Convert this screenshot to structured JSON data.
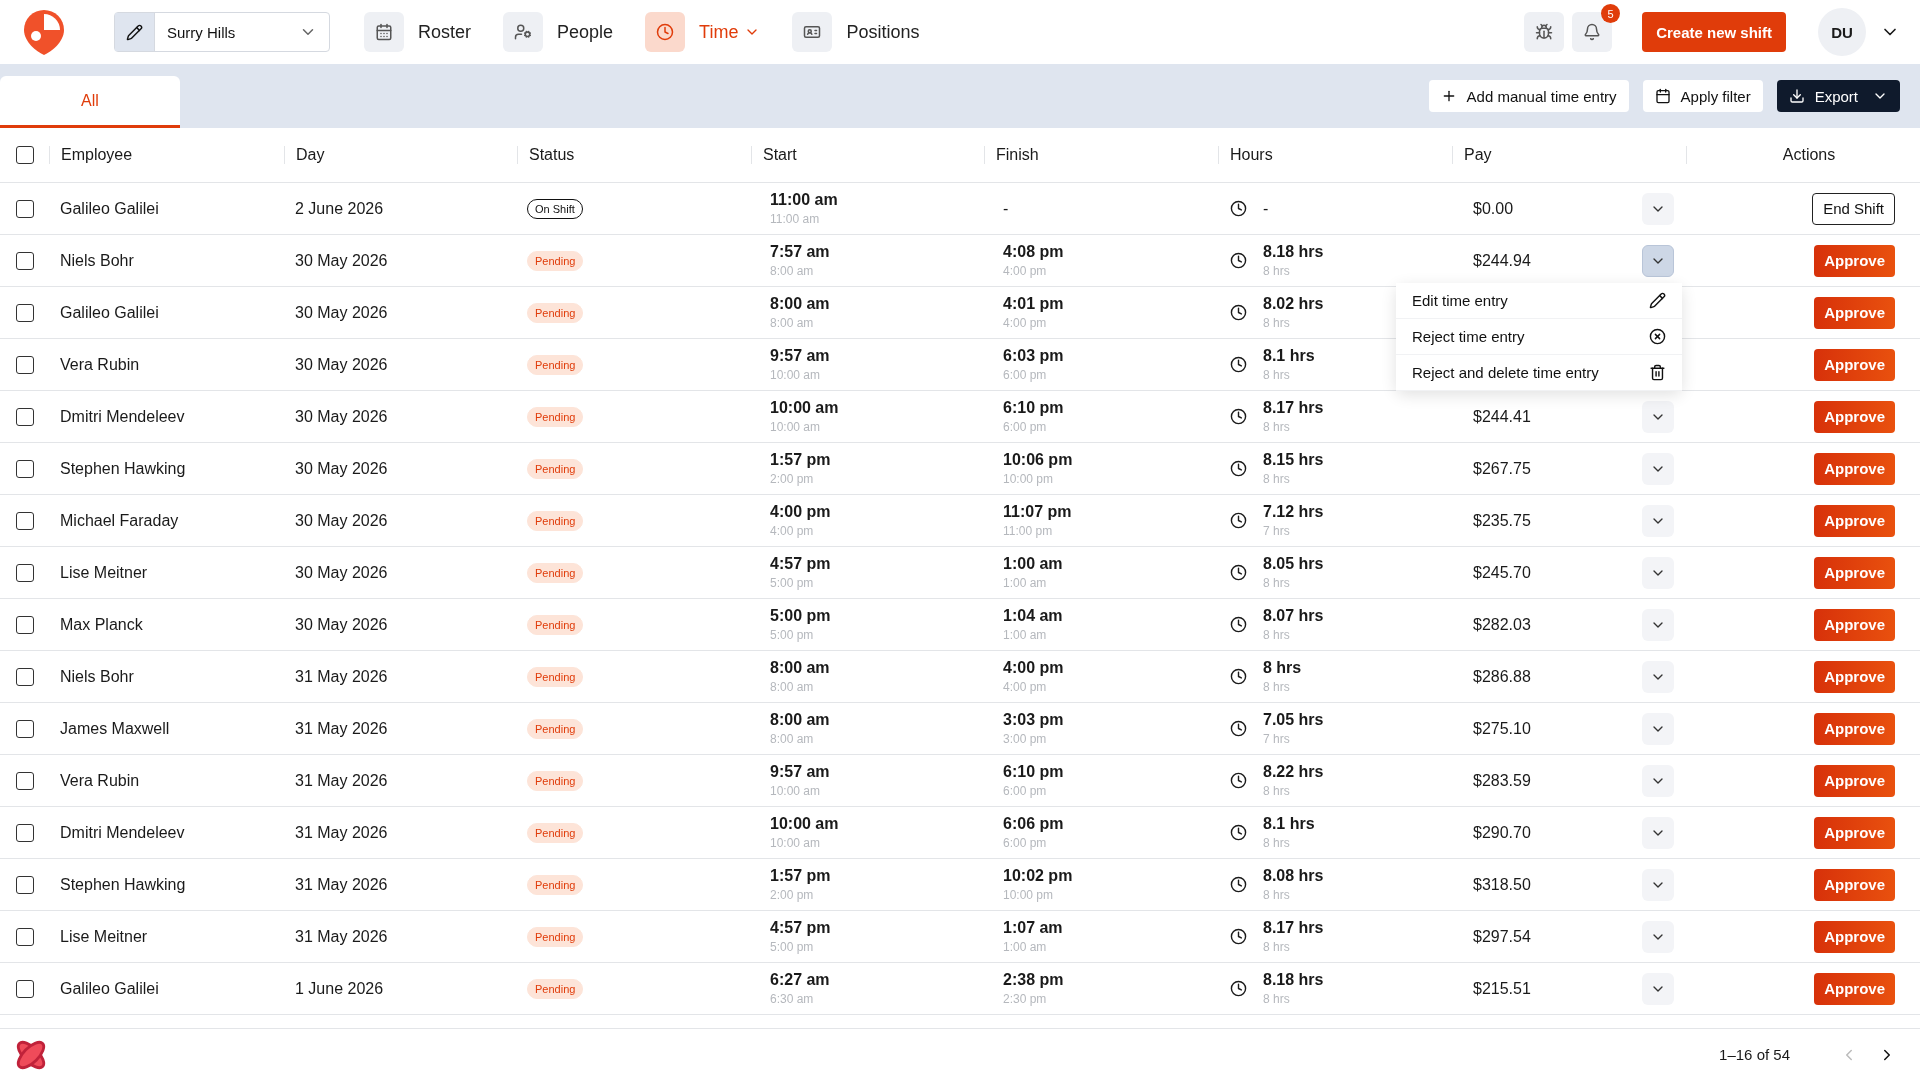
{
  "top_bar": {
    "location": "Surry Hills",
    "nav": [
      {
        "label": "Roster",
        "selected": false,
        "has_menu": false
      },
      {
        "label": "People",
        "selected": false,
        "has_menu": false
      },
      {
        "label": "Time",
        "selected": true,
        "has_menu": true
      },
      {
        "label": "Positions",
        "selected": false,
        "has_menu": false
      }
    ],
    "notification_count": "5",
    "create_button": "Create new shift",
    "avatar": "DU"
  },
  "tabs": [
    {
      "label": "All",
      "selected": true
    }
  ],
  "toolbar": [
    {
      "label": "Add manual time entry",
      "kind": "light"
    },
    {
      "label": "Apply filter",
      "kind": "light"
    },
    {
      "label": "Export",
      "kind": "dark"
    }
  ],
  "table": {
    "select_all": {
      "checked": false
    },
    "columns": [
      "Employee",
      "Day",
      "Status",
      "Start",
      "Finish",
      "Hours",
      "Pay",
      "Actions"
    ],
    "rows": [
      {
        "checked": false,
        "employee": "Galileo Galilei",
        "day": "2 June 2026",
        "status": {
          "label": "On Shift",
          "kind": "on_shift"
        },
        "start": "11:00 am",
        "start_planned": "11:00 am",
        "finish": "-",
        "hours": "-",
        "pay": "$0.00",
        "expanded": false,
        "action": {
          "label": "End Shift",
          "kind": "outline"
        }
      },
      {
        "checked": false,
        "employee": "Niels Bohr",
        "day": "30 May 2026",
        "status": {
          "label": "Pending",
          "kind": "pending"
        },
        "start": "7:57 am",
        "start_planned": "8:00 am",
        "finish": "4:08 pm",
        "finish_planned": "4:00 pm",
        "hours": "8.18 hrs",
        "hours_planned": "8 hrs",
        "pay": "$244.94",
        "expanded": true,
        "action": {
          "label": "Approve",
          "kind": "primary"
        }
      },
      {
        "checked": false,
        "employee": "Galileo Galilei",
        "day": "30 May 2026",
        "status": {
          "label": "Pending",
          "kind": "pending"
        },
        "start": "8:00 am",
        "start_planned": "8:00 am",
        "finish": "4:01 pm",
        "finish_planned": "4:00 pm",
        "hours": "8.02 hrs",
        "hours_planned": "8 hrs",
        "action": {
          "label": "Approve",
          "kind": "primary"
        }
      },
      {
        "checked": false,
        "employee": "Vera Rubin",
        "day": "30 May 2026",
        "status": {
          "label": "Pending",
          "kind": "pending"
        },
        "start": "9:57 am",
        "start_planned": "10:00 am",
        "finish": "6:03 pm",
        "finish_planned": "6:00 pm",
        "hours": "8.1 hrs",
        "hours_planned": "8 hrs",
        "action": {
          "label": "Approve",
          "kind": "primary"
        }
      },
      {
        "checked": false,
        "employee": "Dmitri Mendeleev",
        "day": "30 May 2026",
        "status": {
          "label": "Pending",
          "kind": "pending"
        },
        "start": "10:00 am",
        "start_planned": "10:00 am",
        "finish": "6:10 pm",
        "finish_planned": "6:00 pm",
        "hours": "8.17 hrs",
        "hours_planned": "8 hrs",
        "pay": "$244.41",
        "expanded": false,
        "action": {
          "label": "Approve",
          "kind": "primary"
        }
      },
      {
        "checked": false,
        "employee": "Stephen Hawking",
        "day": "30 May 2026",
        "status": {
          "label": "Pending",
          "kind": "pending"
        },
        "start": "1:57 pm",
        "start_planned": "2:00 pm",
        "finish": "10:06 pm",
        "finish_planned": "10:00 pm",
        "hours": "8.15 hrs",
        "hours_planned": "8 hrs",
        "pay": "$267.75",
        "expanded": false,
        "action": {
          "label": "Approve",
          "kind": "primary"
        }
      },
      {
        "checked": false,
        "employee": "Michael Faraday",
        "day": "30 May 2026",
        "status": {
          "label": "Pending",
          "kind": "pending"
        },
        "start": "4:00 pm",
        "start_planned": "4:00 pm",
        "finish": "11:07 pm",
        "finish_planned": "11:00 pm",
        "hours": "7.12 hrs",
        "hours_planned": "7 hrs",
        "pay": "$235.75",
        "expanded": false,
        "action": {
          "label": "Approve",
          "kind": "primary"
        }
      },
      {
        "checked": false,
        "employee": "Lise Meitner",
        "day": "30 May 2026",
        "status": {
          "label": "Pending",
          "kind": "pending"
        },
        "start": "4:57 pm",
        "start_planned": "5:00 pm",
        "finish": "1:00 am",
        "finish_planned": "1:00 am",
        "hours": "8.05 hrs",
        "hours_planned": "8 hrs",
        "pay": "$245.70",
        "expanded": false,
        "action": {
          "label": "Approve",
          "kind": "primary"
        }
      },
      {
        "checked": false,
        "employee": "Max Planck",
        "day": "30 May 2026",
        "status": {
          "label": "Pending",
          "kind": "pending"
        },
        "start": "5:00 pm",
        "start_planned": "5:00 pm",
        "finish": "1:04 am",
        "finish_planned": "1:00 am",
        "hours": "8.07 hrs",
        "hours_planned": "8 hrs",
        "pay": "$282.03",
        "expanded": false,
        "action": {
          "label": "Approve",
          "kind": "primary"
        }
      },
      {
        "checked": false,
        "employee": "Niels Bohr",
        "day": "31 May 2026",
        "status": {
          "label": "Pending",
          "kind": "pending"
        },
        "start": "8:00 am",
        "start_planned": "8:00 am",
        "finish": "4:00 pm",
        "finish_planned": "4:00 pm",
        "hours": "8 hrs",
        "hours_planned": "8 hrs",
        "pay": "$286.88",
        "expanded": false,
        "action": {
          "label": "Approve",
          "kind": "primary"
        }
      },
      {
        "checked": false,
        "employee": "James Maxwell",
        "day": "31 May 2026",
        "status": {
          "label": "Pending",
          "kind": "pending"
        },
        "start": "8:00 am",
        "start_planned": "8:00 am",
        "finish": "3:03 pm",
        "finish_planned": "3:00 pm",
        "hours": "7.05 hrs",
        "hours_planned": "7 hrs",
        "pay": "$275.10",
        "expanded": false,
        "action": {
          "label": "Approve",
          "kind": "primary"
        }
      },
      {
        "checked": false,
        "employee": "Vera Rubin",
        "day": "31 May 2026",
        "status": {
          "label": "Pending",
          "kind": "pending"
        },
        "start": "9:57 am",
        "start_planned": "10:00 am",
        "finish": "6:10 pm",
        "finish_planned": "6:00 pm",
        "hours": "8.22 hrs",
        "hours_planned": "8 hrs",
        "pay": "$283.59",
        "expanded": false,
        "action": {
          "label": "Approve",
          "kind": "primary"
        }
      },
      {
        "checked": false,
        "employee": "Dmitri Mendeleev",
        "day": "31 May 2026",
        "status": {
          "label": "Pending",
          "kind": "pending"
        },
        "start": "10:00 am",
        "start_planned": "10:00 am",
        "finish": "6:06 pm",
        "finish_planned": "6:00 pm",
        "hours": "8.1 hrs",
        "hours_planned": "8 hrs",
        "pay": "$290.70",
        "expanded": false,
        "action": {
          "label": "Approve",
          "kind": "primary"
        }
      },
      {
        "checked": false,
        "employee": "Stephen Hawking",
        "day": "31 May 2026",
        "status": {
          "label": "Pending",
          "kind": "pending"
        },
        "start": "1:57 pm",
        "start_planned": "2:00 pm",
        "finish": "10:02 pm",
        "finish_planned": "10:00 pm",
        "hours": "8.08 hrs",
        "hours_planned": "8 hrs",
        "pay": "$318.50",
        "expanded": false,
        "action": {
          "label": "Approve",
          "kind": "primary"
        }
      },
      {
        "checked": false,
        "employee": "Lise Meitner",
        "day": "31 May 2026",
        "status": {
          "label": "Pending",
          "kind": "pending"
        },
        "start": "4:57 pm",
        "start_planned": "5:00 pm",
        "finish": "1:07 am",
        "finish_planned": "1:00 am",
        "hours": "8.17 hrs",
        "hours_planned": "8 hrs",
        "pay": "$297.54",
        "expanded": false,
        "action": {
          "label": "Approve",
          "kind": "primary"
        }
      },
      {
        "checked": false,
        "employee": "Galileo Galilei",
        "day": "1 June 2026",
        "status": {
          "label": "Pending",
          "kind": "pending"
        },
        "start": "6:27 am",
        "start_planned": "6:30 am",
        "finish": "2:38 pm",
        "finish_planned": "2:30 pm",
        "hours": "8.18 hrs",
        "hours_planned": "8 hrs",
        "pay": "$215.51",
        "expanded": false,
        "action": {
          "label": "Approve",
          "kind": "primary"
        }
      }
    ]
  },
  "row_menu": {
    "items": [
      {
        "label": "Edit time entry"
      },
      {
        "label": "Reject time entry"
      },
      {
        "label": "Reject and delete time entry"
      }
    ]
  },
  "footer": {
    "range": "1–16 of 54",
    "prev_disabled": true,
    "next_disabled": false
  }
}
